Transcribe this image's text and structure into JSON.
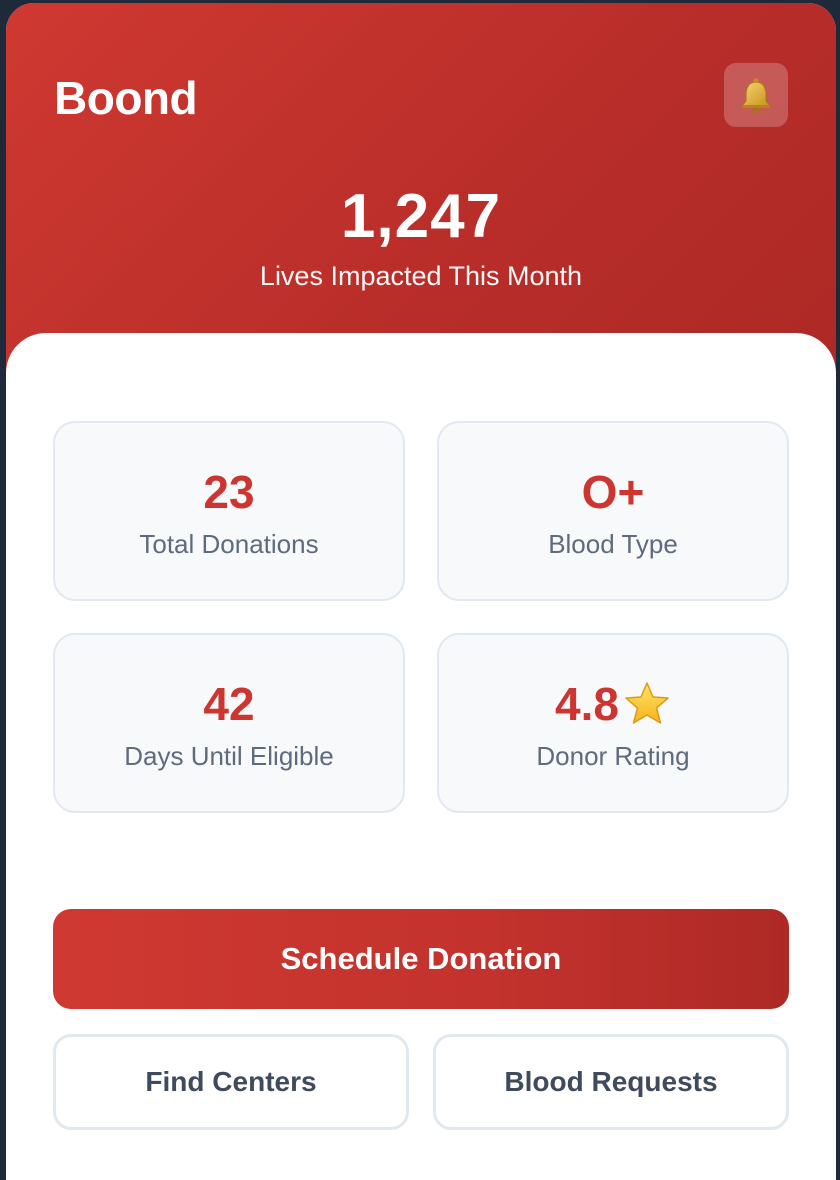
{
  "app": {
    "title": "Boond",
    "notification_icon": "bell-icon"
  },
  "hero": {
    "value": "1,247",
    "caption": "Lives Impacted This Month"
  },
  "stats": [
    {
      "value": "23",
      "label": "Total Donations"
    },
    {
      "value": "O+",
      "label": "Blood Type"
    },
    {
      "value": "42",
      "label": "Days Until Eligible"
    },
    {
      "value": "4.8",
      "label": "Donor Rating",
      "icon": "star-icon"
    }
  ],
  "actions": {
    "primary_label": "Schedule Donation",
    "find_centers_label": "Find Centers",
    "blood_requests_label": "Blood Requests"
  },
  "colors": {
    "brand_red": "#cc3530",
    "header_gradient_start": "#cf3931",
    "header_gradient_end": "#ad2925",
    "label_gray": "#5e6b7e",
    "card_border": "#e2e8f0"
  }
}
